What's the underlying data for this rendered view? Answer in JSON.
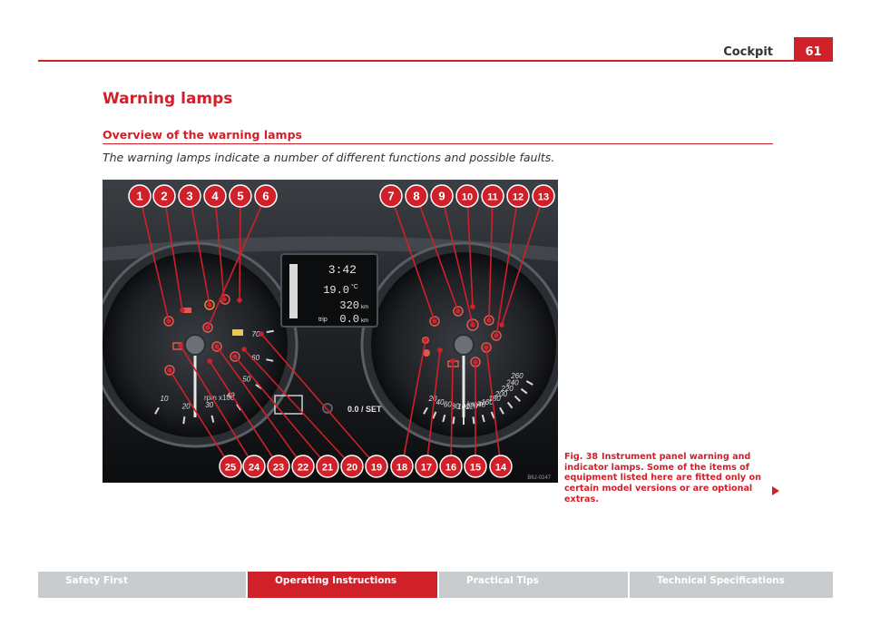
{
  "header": {
    "section": "Cockpit",
    "page_number": "61"
  },
  "title": "Warning lamps",
  "subtitle": "Overview of the warning lamps",
  "intro": "The warning lamps indicate a number of different functions and possible faults.",
  "figure": {
    "callouts": [
      "1",
      "2",
      "3",
      "4",
      "5",
      "6",
      "7",
      "8",
      "9",
      "10",
      "11",
      "12",
      "13",
      "14",
      "15",
      "16",
      "17",
      "18",
      "19",
      "20",
      "21",
      "22",
      "23",
      "24",
      "25"
    ],
    "display": {
      "time": "3:42",
      "temp": "19.0",
      "temp_unit": "°C",
      "odometer": "320",
      "odometer_unit": "km",
      "trip_label": "trip",
      "trip": "0.0",
      "trip_unit": "km"
    },
    "button_label": "0.0 / SET",
    "tacho_unit": "rpm x100",
    "speedo_unit": "km/h",
    "tacho_ticks": [
      "10",
      "20",
      "30",
      "40",
      "50",
      "60",
      "70"
    ],
    "speedo_ticks": [
      "20",
      "40",
      "60",
      "80",
      "100",
      "120",
      "140",
      "160",
      "180",
      "200",
      "220",
      "240",
      "260"
    ],
    "image_code": "B6J-0247"
  },
  "caption": {
    "label": "Fig. 38",
    "text": "Instrument panel warning and indicator lamps. Some of the items of equipment listed here are fitted only on certain model versions or are optional extras."
  },
  "footer": {
    "tabs": [
      "Safety First",
      "Operating Instructions",
      "Practical Tips",
      "Technical Specifications"
    ],
    "active_index": 1
  },
  "colors": {
    "accent": "#d0202a",
    "footer_grey": "#c8ccce"
  },
  "icons": [
    "next-page-arrow-icon"
  ]
}
